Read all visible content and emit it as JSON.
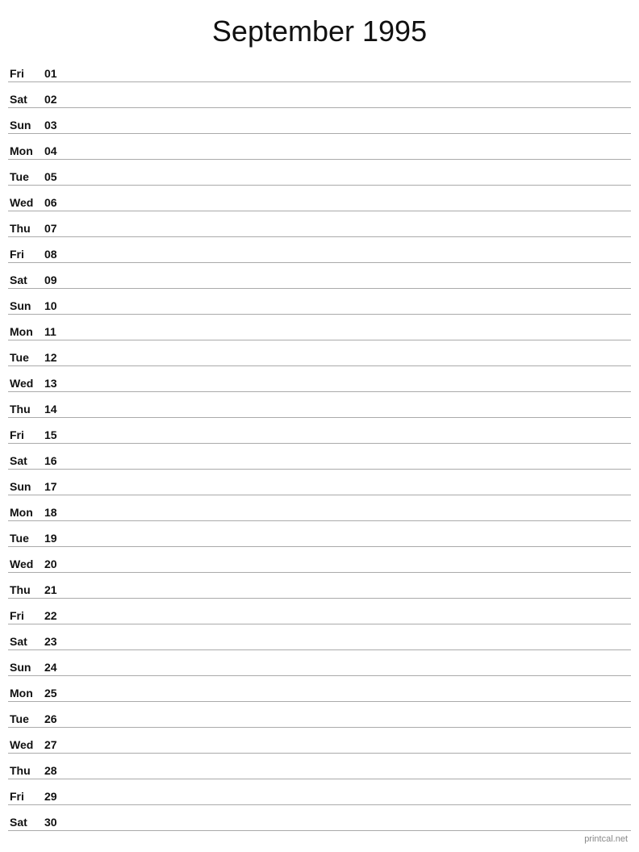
{
  "title": "September 1995",
  "days": [
    {
      "name": "Fri",
      "number": "01"
    },
    {
      "name": "Sat",
      "number": "02"
    },
    {
      "name": "Sun",
      "number": "03"
    },
    {
      "name": "Mon",
      "number": "04"
    },
    {
      "name": "Tue",
      "number": "05"
    },
    {
      "name": "Wed",
      "number": "06"
    },
    {
      "name": "Thu",
      "number": "07"
    },
    {
      "name": "Fri",
      "number": "08"
    },
    {
      "name": "Sat",
      "number": "09"
    },
    {
      "name": "Sun",
      "number": "10"
    },
    {
      "name": "Mon",
      "number": "11"
    },
    {
      "name": "Tue",
      "number": "12"
    },
    {
      "name": "Wed",
      "number": "13"
    },
    {
      "name": "Thu",
      "number": "14"
    },
    {
      "name": "Fri",
      "number": "15"
    },
    {
      "name": "Sat",
      "number": "16"
    },
    {
      "name": "Sun",
      "number": "17"
    },
    {
      "name": "Mon",
      "number": "18"
    },
    {
      "name": "Tue",
      "number": "19"
    },
    {
      "name": "Wed",
      "number": "20"
    },
    {
      "name": "Thu",
      "number": "21"
    },
    {
      "name": "Fri",
      "number": "22"
    },
    {
      "name": "Sat",
      "number": "23"
    },
    {
      "name": "Sun",
      "number": "24"
    },
    {
      "name": "Mon",
      "number": "25"
    },
    {
      "name": "Tue",
      "number": "26"
    },
    {
      "name": "Wed",
      "number": "27"
    },
    {
      "name": "Thu",
      "number": "28"
    },
    {
      "name": "Fri",
      "number": "29"
    },
    {
      "name": "Sat",
      "number": "30"
    }
  ],
  "footer": "printcal.net"
}
